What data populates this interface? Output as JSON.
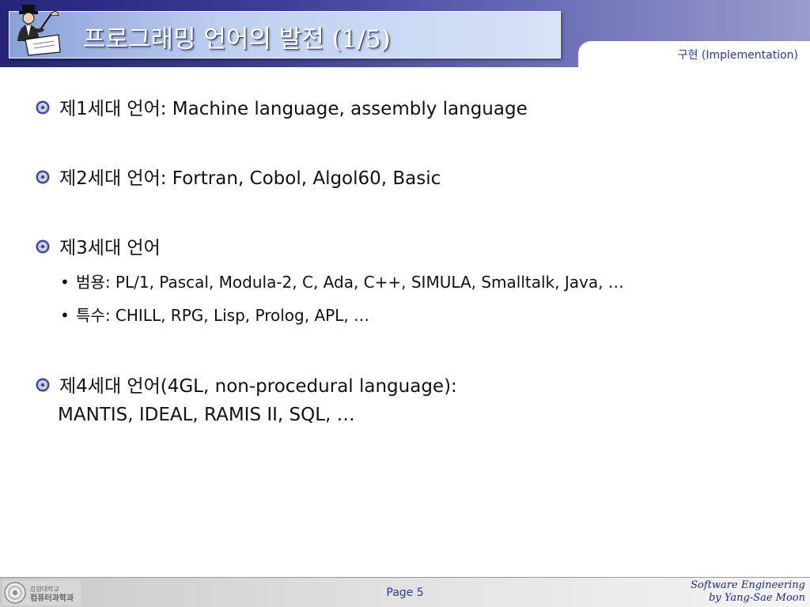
{
  "header": {
    "title": "프로그래밍 언어의 발전 (1/5)",
    "subtitle_ko": "구현",
    "subtitle_en": "(Implementation)"
  },
  "bullets": [
    {
      "label": "제1세대 언어",
      "text": ": Machine language, assembly language"
    },
    {
      "label": "제2세대 언어",
      "text": ": Fortran, Cobol, Algol60, Basic"
    },
    {
      "label": "제3세대 언어",
      "text": ""
    },
    {
      "label": "제4세대 언어",
      "text": "(4GL, non-procedural language):"
    }
  ],
  "sub_bullets": [
    {
      "label": "범용",
      "text": ": PL/1, Pascal, Modula-2, C, Ada, C++, SIMULA, Smalltalk, Java, …"
    },
    {
      "label": "특수",
      "text": ": CHILL, RPG, Lisp, Prolog, APL, …"
    }
  ],
  "continuation": "MANTIS, IDEAL, RAMIS II, SQL, …",
  "footer": {
    "page": "Page 5",
    "credit_line1": "Software Engineering",
    "credit_line2": "by Yang-Sae Moon",
    "dept_line1": "강원대학교",
    "dept_line2": "컴퓨터과학과"
  }
}
